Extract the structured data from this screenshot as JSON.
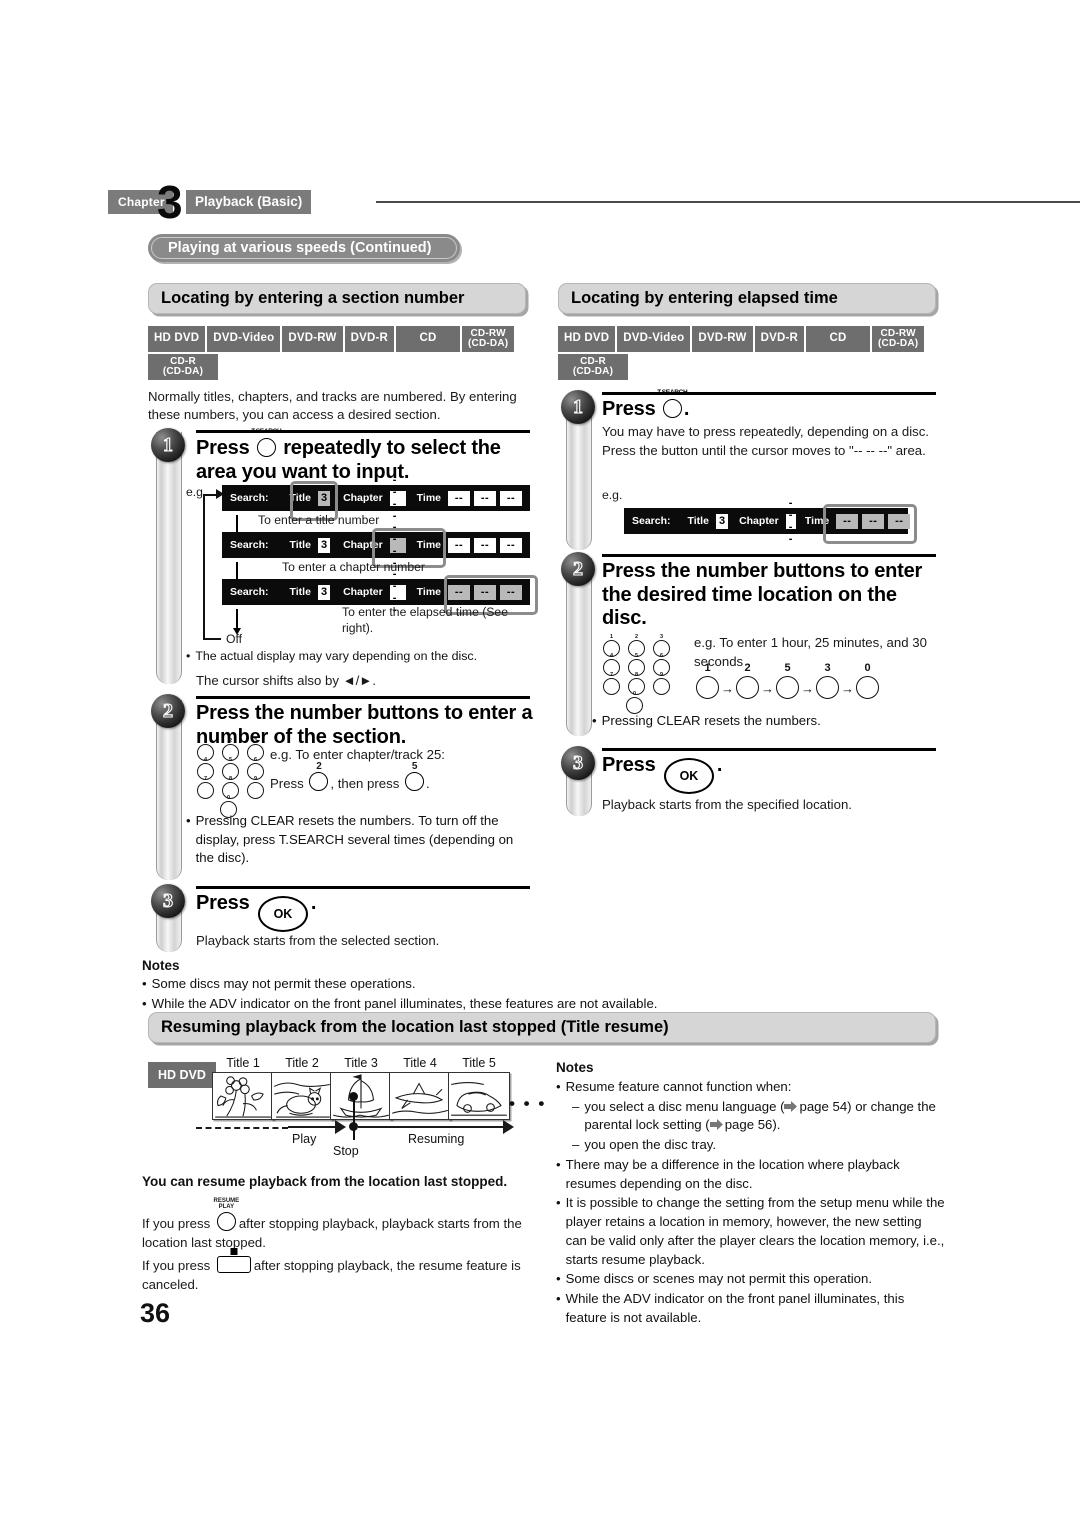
{
  "header": {
    "chapter_label": "Chapter",
    "chapter_number": "3",
    "chapter_title": "Playback (Basic)"
  },
  "banner": {
    "continued": "Playing at various speeds (Continued)"
  },
  "page_number": "36",
  "disc_badges": {
    "row1": [
      "HD DVD",
      "DVD-Video",
      "DVD-RW",
      "DVD-R",
      "CD"
    ],
    "cd_rw": {
      "line1": "CD-RW",
      "line2": "(CD-DA)"
    },
    "cd_r": {
      "line1": "CD-R",
      "line2": "(CD-DA)"
    }
  },
  "left_section": {
    "heading": "Locating by entering a section number",
    "intro": "Normally titles, chapters, and tracks are numbered. By entering these numbers, you can access a desired section.",
    "step1": {
      "number": "1",
      "title_before": "Press",
      "button_caption": "T.SEARCH",
      "title_after": "repeatedly to select the area you want to input.",
      "eg_label": "e.g.",
      "osd_rows": [
        {
          "search": "Search:",
          "title_label": "Title",
          "title_value": "3",
          "chapter_label": "Chapter",
          "chapter_value": "- - - -",
          "time_label": "Time",
          "time_values": [
            "--",
            "--",
            "--"
          ],
          "selected": "title",
          "caption": "To enter a title number"
        },
        {
          "search": "Search:",
          "title_label": "Title",
          "title_value": "3",
          "chapter_label": "Chapter",
          "chapter_value": "- - - -",
          "time_label": "Time",
          "time_values": [
            "--",
            "--",
            "--"
          ],
          "selected": "chapter",
          "caption": "To enter a chapter number"
        },
        {
          "search": "Search:",
          "title_label": "Title",
          "title_value": "3",
          "chapter_label": "Chapter",
          "chapter_value": "- - - -",
          "time_label": "Time",
          "time_values": [
            "--",
            "--",
            "--"
          ],
          "selected": "time",
          "caption": "To enter the elapsed time (See right)."
        }
      ],
      "off_label": "Off",
      "note": "The actual display may vary depending on the disc.",
      "cursor_note": "The cursor shifts also by ◄/►."
    },
    "step2": {
      "number": "2",
      "title": "Press the number buttons to enter a number of the section.",
      "example_line": "e.g. To enter chapter/track 25:",
      "press_prefix": "Press",
      "press_middle": ", then press",
      "press_suffix": ".",
      "first_key": "2",
      "second_key": "5",
      "note": "Pressing CLEAR resets the numbers. To turn off the display, press T.SEARCH several times (depending on the disc)."
    },
    "step3": {
      "number": "3",
      "title_before": "Press",
      "ok_label": "OK",
      "title_after": ".",
      "body": "Playback starts from the selected section."
    },
    "notes_title": "Notes",
    "notes": [
      "Some discs may not permit these operations.",
      "While the ADV indicator on the front panel illuminates, these features are not available."
    ]
  },
  "right_section": {
    "heading": "Locating by entering elapsed time",
    "step1": {
      "number": "1",
      "title_before": "Press",
      "button_caption": "T.SEARCH",
      "title_after": ".",
      "body": "You may have to press repeatedly, depending on a disc. Press the button until the cursor moves to \"-- -- --\" area.",
      "eg_label": "e.g.",
      "osd": {
        "search": "Search:",
        "title_label": "Title",
        "title_value": "3",
        "chapter_label": "Chapter",
        "chapter_value": "- - - -",
        "time_label": "Time",
        "time_values": [
          "--",
          "--",
          "--"
        ],
        "selected": "time"
      }
    },
    "step2": {
      "number": "2",
      "title": "Press the number buttons to enter the desired time location on the disc.",
      "example_line": "e.g. To enter 1 hour, 25 minutes, and 30 seconds",
      "sequence": [
        "1",
        "2",
        "5",
        "3",
        "0"
      ],
      "note": "Pressing CLEAR resets the numbers."
    },
    "step3": {
      "number": "3",
      "title_before": "Press",
      "ok_label": "OK",
      "title_after": ".",
      "body": "Playback starts from the specified location."
    }
  },
  "resume_section": {
    "heading": "Resuming playback from the location last stopped (Title resume)",
    "hd_dvd_badge": "HD DVD",
    "titles": [
      {
        "caption": "Title 1",
        "icon": "flowers-icon"
      },
      {
        "caption": "Title 2",
        "icon": "cat-icon"
      },
      {
        "caption": "Title 3",
        "icon": "sailing-ship-icon"
      },
      {
        "caption": "Title 4",
        "icon": "airplane-icon"
      },
      {
        "caption": "Title 5",
        "icon": "car-icon"
      }
    ],
    "ellipsis": "• • •",
    "timeline": {
      "play": "Play",
      "stop": "Stop",
      "resuming": "Resuming"
    },
    "sub_heading": "You can resume playback from the location last stopped.",
    "resume_button_caption_line1": "RESUME",
    "resume_button_caption_line2": "PLAY",
    "body_1_before": "If you press",
    "body_1_after": "after stopping playback, playback starts from the location last stopped.",
    "body_2_before": "If you press",
    "body_2_after": "after stopping playback, the resume feature is canceled.",
    "notes_title": "Notes",
    "notes": [
      {
        "text": "Resume feature cannot function when:",
        "sub": [
          "you select a disc menu language (→ page 54) or change the parental lock setting (→ page 56).",
          "you open the disc tray."
        ]
      },
      {
        "text": "There may be a difference in the location where playback resumes depending on the disc.",
        "sub": []
      },
      {
        "text": "It is possible to change the setting from the setup menu while the player retains a location in memory, however, the new setting can be valid only after the player clears the location memory, i.e., starts resume playback.",
        "sub": []
      },
      {
        "text": "Some discs or scenes may not permit this operation.",
        "sub": []
      },
      {
        "text": "While the ADV indicator on the front panel illuminates, this feature is not available.",
        "sub": []
      }
    ],
    "page_refs": {
      "menu_language": "page 54",
      "parental_lock": "page 56"
    }
  },
  "colors": {
    "badge_gray": "#6e6e6e",
    "pill_gray": "#8a8a8a",
    "head_gray": "#d6d6d6",
    "osd_black": "#0b0b0b",
    "cursor_gray": "#8c8c8c"
  }
}
